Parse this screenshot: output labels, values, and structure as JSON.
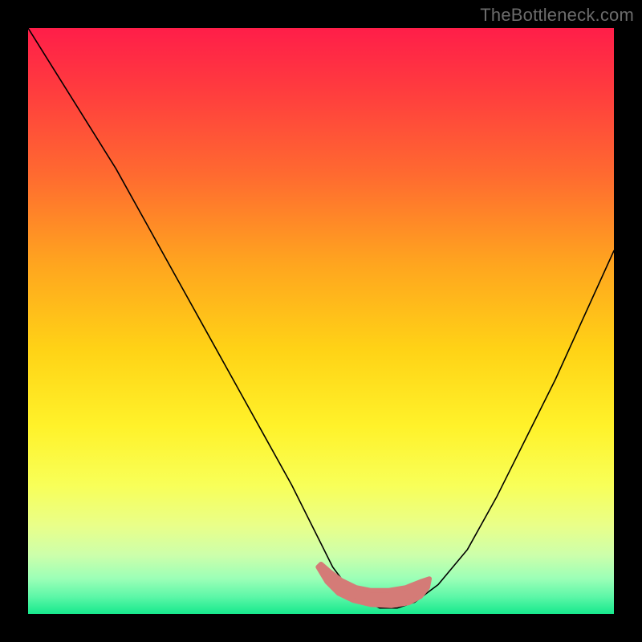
{
  "watermark": "TheBottleneck.com",
  "chart_data": {
    "type": "line",
    "title": "",
    "xlabel": "",
    "ylabel": "",
    "xlim": [
      0,
      100
    ],
    "ylim": [
      0,
      100
    ],
    "background_gradient": {
      "stops": [
        {
          "offset": 0.0,
          "color": "#ff1e49"
        },
        {
          "offset": 0.1,
          "color": "#ff3a3f"
        },
        {
          "offset": 0.25,
          "color": "#ff6a30"
        },
        {
          "offset": 0.4,
          "color": "#ffa41f"
        },
        {
          "offset": 0.55,
          "color": "#ffd316"
        },
        {
          "offset": 0.68,
          "color": "#fff22a"
        },
        {
          "offset": 0.78,
          "color": "#f8ff58"
        },
        {
          "offset": 0.85,
          "color": "#e9ff8a"
        },
        {
          "offset": 0.9,
          "color": "#ccffab"
        },
        {
          "offset": 0.94,
          "color": "#9bffb7"
        },
        {
          "offset": 0.97,
          "color": "#5ef7a8"
        },
        {
          "offset": 1.0,
          "color": "#17e98d"
        }
      ]
    },
    "series": [
      {
        "name": "bottleneck-curve",
        "color": "#000000",
        "stroke_width": 1.6,
        "x": [
          0,
          5,
          10,
          15,
          20,
          25,
          30,
          35,
          40,
          45,
          50,
          52,
          55,
          58,
          60,
          63,
          66,
          70,
          75,
          80,
          85,
          90,
          95,
          100
        ],
        "values": [
          100,
          92,
          84,
          76,
          67,
          58,
          49,
          40,
          31,
          22,
          12,
          8,
          4,
          2,
          1,
          1,
          2,
          5,
          11,
          20,
          30,
          40,
          51,
          62
        ]
      },
      {
        "name": "bottom-marker-blob",
        "type": "filled_path",
        "color": "#d47b77",
        "points": [
          [
            49.5,
            8.0
          ],
          [
            51.0,
            5.5
          ],
          [
            53.0,
            3.5
          ],
          [
            55.5,
            2.3
          ],
          [
            58.5,
            1.6
          ],
          [
            62.0,
            1.4
          ],
          [
            65.0,
            1.9
          ],
          [
            67.0,
            3.0
          ],
          [
            68.2,
            4.5
          ],
          [
            68.5,
            6.0
          ],
          [
            67.0,
            5.5
          ],
          [
            64.5,
            4.5
          ],
          [
            61.5,
            4.0
          ],
          [
            58.5,
            4.0
          ],
          [
            56.0,
            4.5
          ],
          [
            53.5,
            5.7
          ],
          [
            51.5,
            7.2
          ],
          [
            50.0,
            8.5
          ]
        ]
      }
    ]
  }
}
